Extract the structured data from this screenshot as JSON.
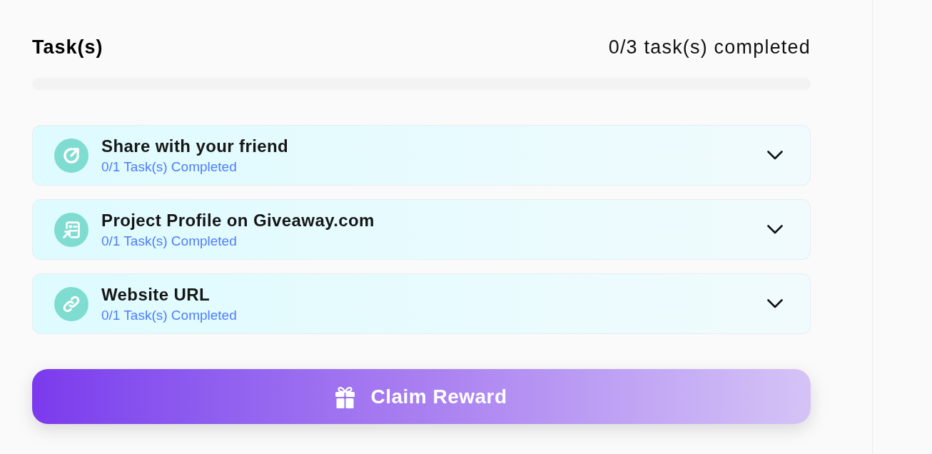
{
  "header": {
    "title": "Task(s)",
    "summary": "0/3 task(s) completed"
  },
  "progress": {
    "level": 0
  },
  "tasks": [
    {
      "kind": "share",
      "title": "Share with your friend",
      "status": "0/1 Task(s) Completed",
      "expanded": false
    },
    {
      "kind": "profile",
      "title": "Project Profile on Giveaway.com",
      "status": "0/1 Task(s) Completed",
      "expanded": false
    },
    {
      "kind": "link",
      "title": "Website URL",
      "status": "0/1 Task(s) Completed",
      "expanded": false
    }
  ],
  "claim_button": {
    "label": "Claim Reward"
  }
}
